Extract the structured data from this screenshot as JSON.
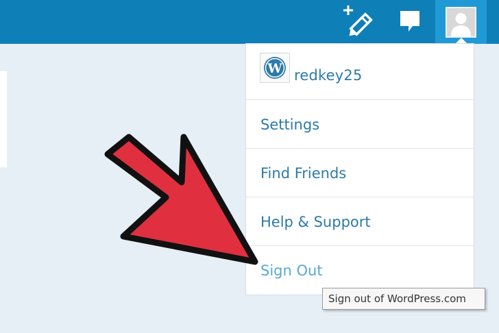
{
  "topbar": {
    "write_icon": "write-post-icon",
    "notifications_icon": "notifications-icon",
    "avatar_icon": "user-avatar-icon",
    "color": "#0f7fb8"
  },
  "menu": {
    "user": {
      "logo_icon": "wordpress-logo-icon",
      "username": "redkey25"
    },
    "items": [
      {
        "label": "Settings"
      },
      {
        "label": "Find Friends"
      },
      {
        "label": "Help & Support"
      },
      {
        "label": "Sign Out"
      }
    ]
  },
  "tooltip": {
    "text": "Sign out of WordPress.com"
  },
  "overlay": {
    "arrow_icon": "pointer-arrow-icon",
    "arrow_color": "#e03040"
  }
}
